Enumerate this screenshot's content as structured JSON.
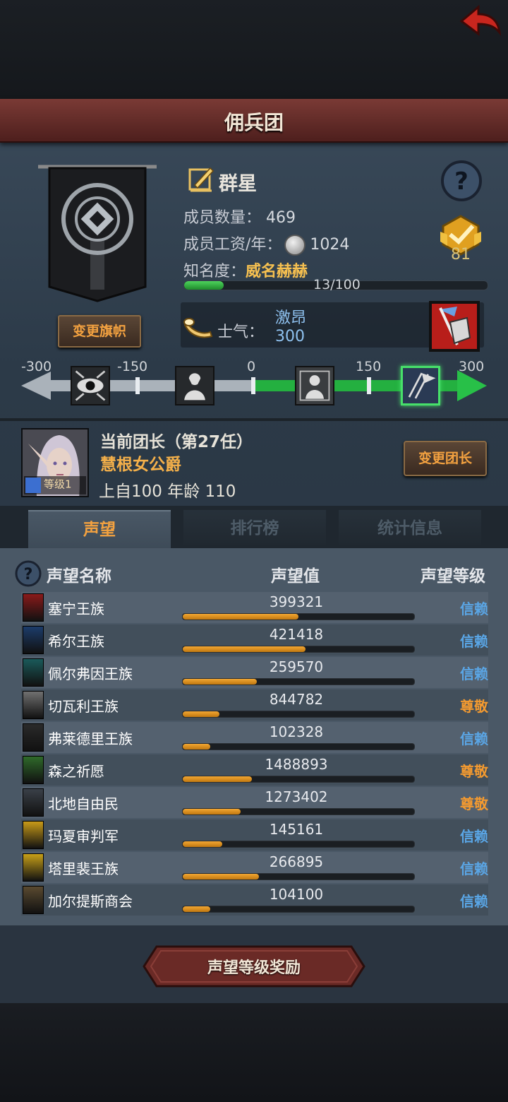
{
  "header": {
    "title": "佣兵团"
  },
  "guild": {
    "name": "群星",
    "member_count_label": "成员数量：",
    "member_count": "469",
    "salary_label": "成员工资/年：",
    "salary": "1024",
    "fame_label": "知名度：",
    "fame_value": "威名赫赫",
    "fame_progress": "13/100",
    "fame_fraction": 0.13,
    "medal_count": "81",
    "change_flag_label": "变更旗帜"
  },
  "morale": {
    "label": "士气：",
    "state": "激昂",
    "value": "300"
  },
  "scale": {
    "ticks": [
      "-300",
      "-150",
      "0",
      "150",
      "300"
    ],
    "current_value": 300
  },
  "leader": {
    "title": "当前团长（第27任）",
    "name": "慧根女公爵",
    "level_label": "等级1",
    "stats": "上自100 年龄 110",
    "change_label": "变更团长"
  },
  "tabs": [
    {
      "label": "声望",
      "active": true
    },
    {
      "label": "排行榜",
      "active": false
    },
    {
      "label": "统计信息",
      "active": false
    }
  ],
  "table": {
    "col_name": "声望名称",
    "col_value": "声望值",
    "col_level": "声望等级",
    "rows": [
      {
        "name": "塞宁王族",
        "value": "399321",
        "level": "信赖",
        "fill": 0.5,
        "crest_color": "#8a1a1a"
      },
      {
        "name": "希尔王族",
        "value": "421418",
        "level": "信赖",
        "fill": 0.53,
        "crest_color": "#1c3c6a"
      },
      {
        "name": "佩尔弗因王族",
        "value": "259570",
        "level": "信赖",
        "fill": 0.32,
        "crest_color": "#1a5a5a"
      },
      {
        "name": "切瓦利王族",
        "value": "844782",
        "level": "尊敬",
        "fill": 0.16,
        "crest_color": "#707070"
      },
      {
        "name": "弗莱德里王族",
        "value": "102328",
        "level": "信赖",
        "fill": 0.12,
        "crest_color": "#2a2a2a"
      },
      {
        "name": "森之祈愿",
        "value": "1488893",
        "level": "尊敬",
        "fill": 0.3,
        "crest_color": "#2f6a2a"
      },
      {
        "name": "北地自由民",
        "value": "1273402",
        "level": "尊敬",
        "fill": 0.25,
        "crest_color": "#3a4048"
      },
      {
        "name": "玛夏审判军",
        "value": "145161",
        "level": "信赖",
        "fill": 0.17,
        "crest_color": "#c89a18"
      },
      {
        "name": "塔里裴王族",
        "value": "266895",
        "level": "信赖",
        "fill": 0.33,
        "crest_color": "#c8a018"
      },
      {
        "name": "加尔提斯商会",
        "value": "104100",
        "level": "信赖",
        "fill": 0.12,
        "crest_color": "#5a4a30"
      }
    ]
  },
  "reward_button": {
    "label": "声望等级奖励"
  },
  "colors": {
    "accent_orange": "#f4a240",
    "trust_blue": "#5aa6e6",
    "respect_orange": "#f39a30",
    "header_red": "#6a2c28"
  }
}
